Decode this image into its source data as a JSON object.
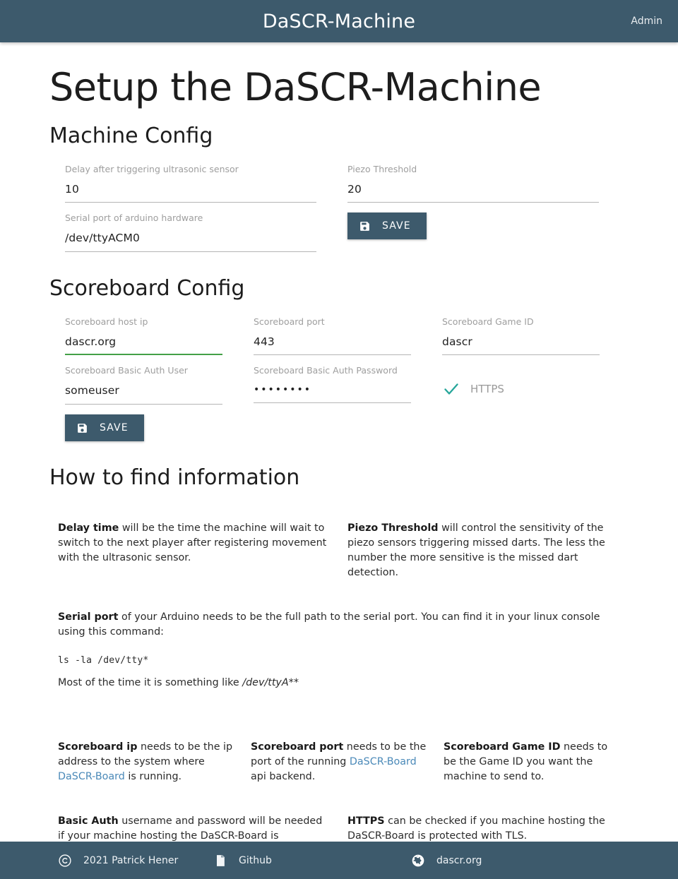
{
  "header": {
    "title": "DaSCR-Machine",
    "admin_label": "Admin"
  },
  "page": {
    "title": "Setup the DaSCR-Machine"
  },
  "machine_config": {
    "section_title": "Machine Config",
    "fields": [
      {
        "label": "Delay after triggering ultrasonic sensor",
        "value": "10"
      },
      {
        "label": "Piezo Threshold",
        "value": "20"
      },
      {
        "label": "Serial port of arduino hardware",
        "value": "/dev/ttyACM0"
      }
    ],
    "save_label": "SAVE"
  },
  "scoreboard_config": {
    "section_title": "Scoreboard Config",
    "fields": [
      {
        "label": "Scoreboard host ip",
        "value": "dascr.org"
      },
      {
        "label": "Scoreboard port",
        "value": "443"
      },
      {
        "label": "Scoreboard Game ID",
        "value": "dascr"
      },
      {
        "label": "Scoreboard Basic Auth User",
        "value": "someuser"
      },
      {
        "label": "Scoreboard Basic Auth Password",
        "value": "••••••••"
      }
    ],
    "https_label": "HTTPS",
    "https_checked": true,
    "save_label": "SAVE"
  },
  "info": {
    "section_title": "How to find information",
    "delay": {
      "bold": "Delay time",
      "rest": " will be the time the machine will wait to switch to the next player after registering movement with the ultrasonic sensor."
    },
    "piezo": {
      "bold": "Piezo Threshold",
      "rest": " will control the sensitivity of the piezo sensors triggering missed darts. The less the number the more sensitive is the missed dart detection."
    },
    "serial": {
      "bold": "Serial port",
      "rest": " of your Arduino needs to be the full path to the serial port. You can find it in your linux console using this command:",
      "code": "ls -la /dev/tty*",
      "note_pre": "Most of the time it is something like ",
      "note_italic": "/dev/ttyA**"
    },
    "scoreboard_ip": {
      "bold": "Scoreboard ip",
      "part1": " needs to be the ip address to the system where ",
      "link": "DaSCR-Board",
      "part2": " is running."
    },
    "scoreboard_port": {
      "bold": "Scoreboard port",
      "part1": " needs to be the port of the running ",
      "link": "DaSCR-Board",
      "part2": " api backend."
    },
    "scoreboard_gameid": {
      "bold": "Scoreboard Game ID",
      "rest": " needs to be the Game ID you want the machine to send to."
    },
    "basic_auth": {
      "bold": "Basic Auth",
      "rest": " username and password will be needed if your machine hosting the DaSCR-Board is protected with a password"
    },
    "https": {
      "bold": "HTTPS",
      "rest": " can be checked if you machine hosting the DaSCR-Board is protected with TLS."
    }
  },
  "footer": {
    "items": [
      {
        "icon": "copyright-icon",
        "label": "2021 Patrick Hener"
      },
      {
        "icon": "github-icon",
        "label": "Github"
      },
      {
        "icon": "globe-icon",
        "label": "dascr.org"
      }
    ]
  },
  "colors": {
    "brand": "#3d5a6c",
    "valid_underline": "#43a047",
    "check_teal": "#26a69a",
    "link": "#4a89b8"
  }
}
